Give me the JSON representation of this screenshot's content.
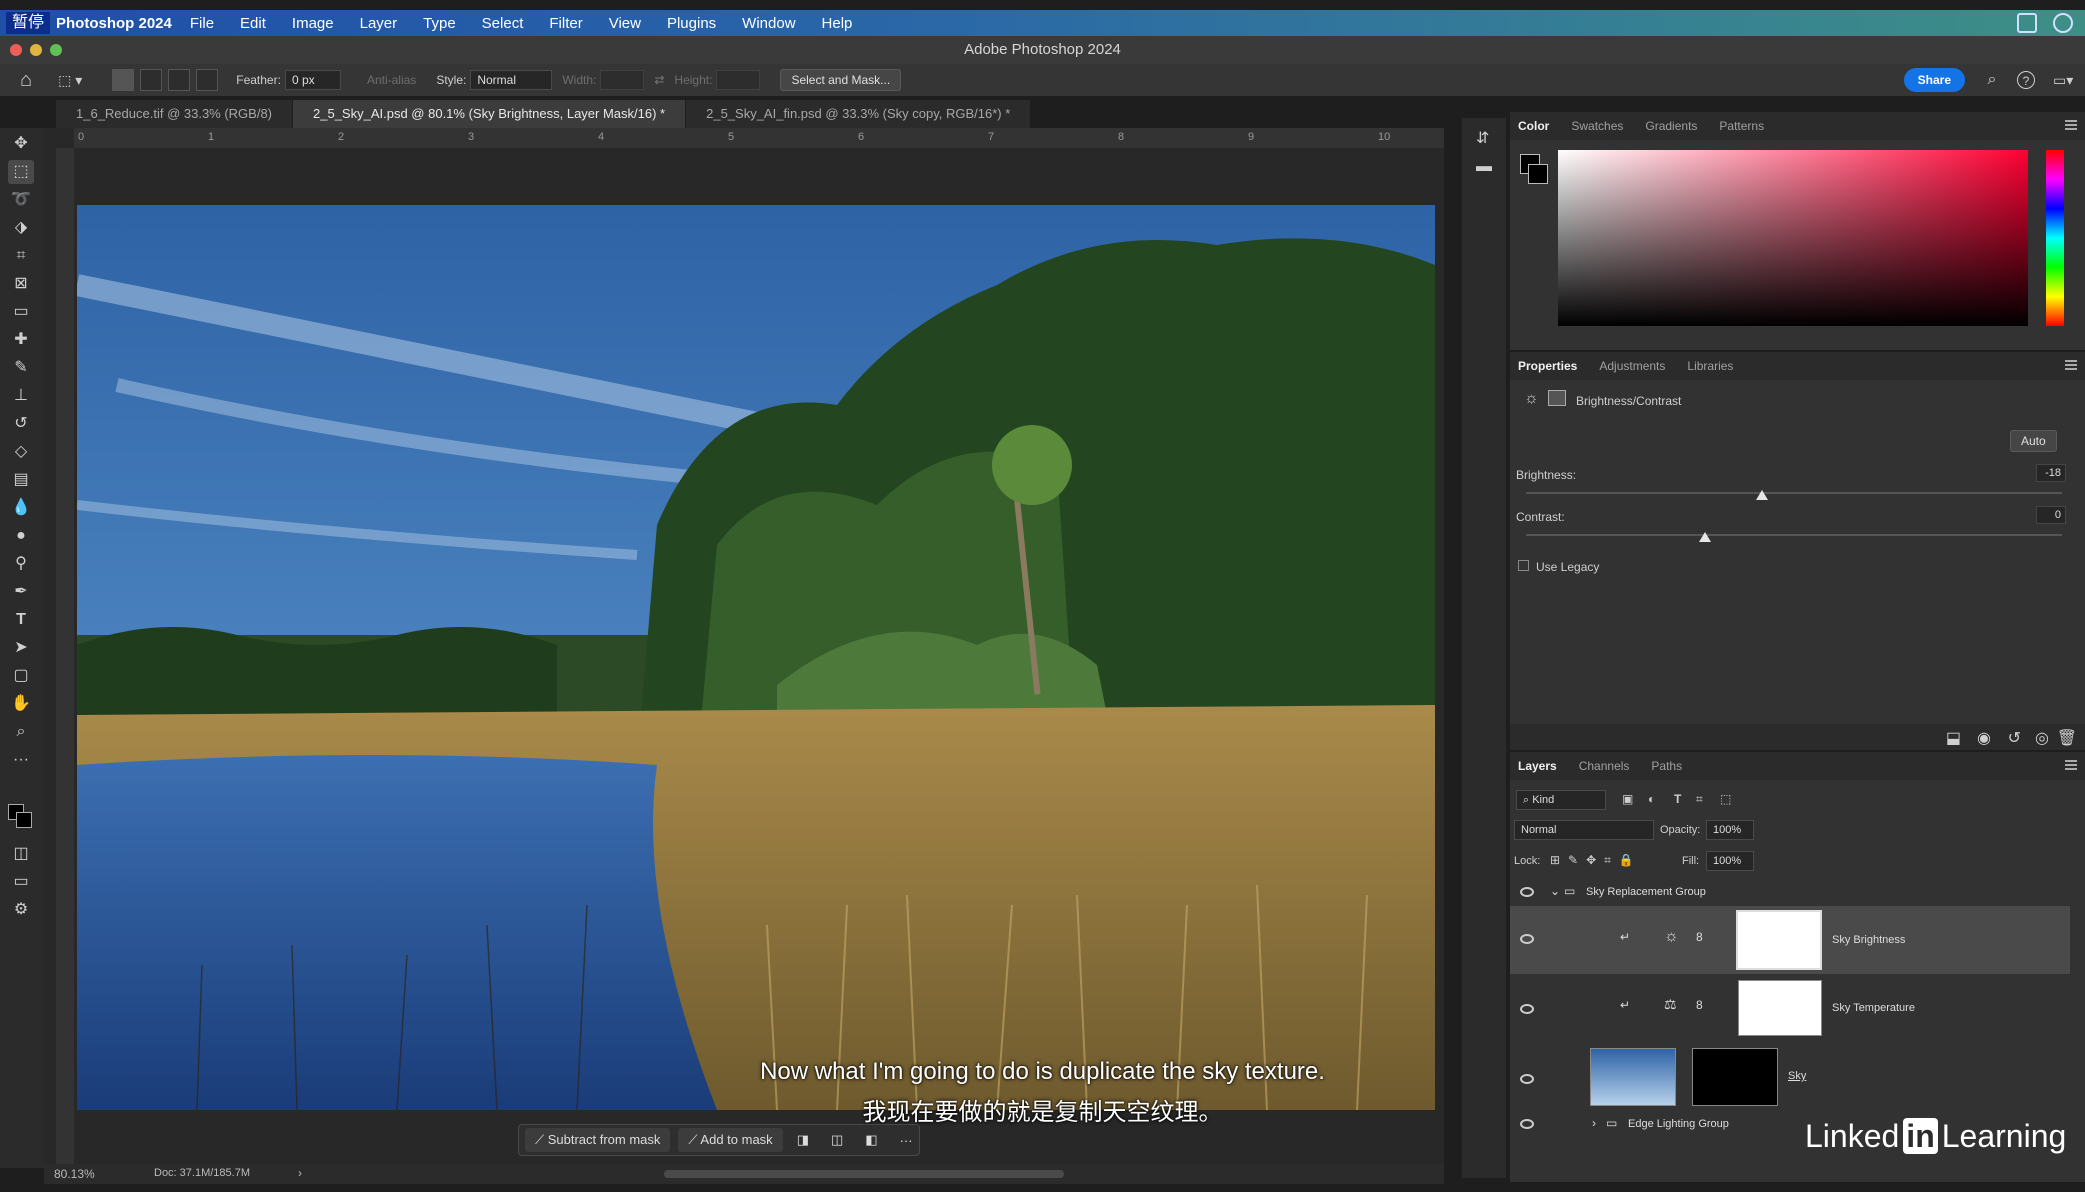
{
  "menubar": {
    "paused_label": "暂停",
    "app_name": "Photoshop 2024",
    "items": [
      "File",
      "Edit",
      "Image",
      "Layer",
      "Type",
      "Select",
      "Filter",
      "View",
      "Plugins",
      "Window",
      "Help"
    ]
  },
  "window": {
    "title": "Adobe Photoshop 2024"
  },
  "options": {
    "feather_label": "Feather:",
    "feather_value": "0 px",
    "anti_alias_label": "Anti-alias",
    "style_label": "Style:",
    "style_value": "Normal",
    "width_label": "Width:",
    "height_label": "Height:",
    "select_mask_label": "Select and Mask...",
    "share_label": "Share"
  },
  "tabs": [
    {
      "label": "1_6_Reduce.tif @ 33.3% (RGB/8)"
    },
    {
      "label": "2_5_Sky_AI.psd @ 80.1% (Sky Brightness, Layer Mask/16) *"
    },
    {
      "label": "2_5_Sky_AI_fin.psd @ 33.3% (Sky copy, RGB/16*) *"
    }
  ],
  "ruler": {
    "ticks": [
      "0",
      "1",
      "2",
      "3",
      "4",
      "5",
      "6",
      "7",
      "8",
      "9",
      "10"
    ]
  },
  "context_bar": {
    "subtract_label": "Subtract from mask",
    "add_label": "Add to mask",
    "more_label": "···"
  },
  "subtitles": {
    "english": "Now what I'm going to do is duplicate the sky texture.",
    "chinese": "我现在要做的就是复制天空纹理。"
  },
  "status": {
    "zoom": "80.13%",
    "doc": "Doc: 37.1M/185.7M",
    "arrow": "›"
  },
  "color_panel": {
    "tabs": [
      "Color",
      "Swatches",
      "Gradients",
      "Patterns"
    ]
  },
  "properties_panel": {
    "tabs": [
      "Properties",
      "Adjustments",
      "Libraries"
    ],
    "adjustment_name": "Brightness/Contrast",
    "auto_label": "Auto",
    "brightness_label": "Brightness:",
    "brightness_value": "-18",
    "contrast_label": "Contrast:",
    "contrast_value": "0",
    "use_legacy_label": "Use Legacy",
    "brightness_level": -18,
    "contrast_level": 0
  },
  "layers_panel": {
    "tabs": [
      "Layers",
      "Channels",
      "Paths"
    ],
    "filter_label": "Kind",
    "blend_mode": "Normal",
    "opacity_label": "Opacity:",
    "opacity_value": "100%",
    "lock_label": "Lock:",
    "fill_label": "Fill:",
    "fill_value": "100%",
    "layers": [
      {
        "name": "Sky Replacement Group",
        "type": "group"
      },
      {
        "name": "Sky Brightness",
        "type": "adjustment"
      },
      {
        "name": "Sky Temperature",
        "type": "adjustment"
      },
      {
        "name": "Sky",
        "type": "image"
      },
      {
        "name": "Edge Lighting Group",
        "type": "group"
      }
    ]
  },
  "watermark": {
    "brand": "Linked",
    "in": "in",
    "learning": "Learning"
  },
  "colors": {
    "accent": "#1473e6",
    "panel": "#323232",
    "bg": "#1e1e1e"
  }
}
